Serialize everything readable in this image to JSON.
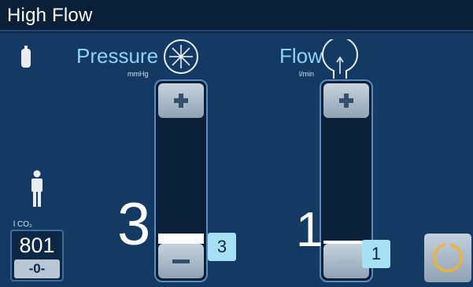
{
  "title": "High Flow",
  "icons": {
    "oxygen_cylinder": "oxygen-cylinder-icon",
    "patient": "adult-patient-icon",
    "pressure_dial": "pressure-dial-icon",
    "flow_loop": "flow-loop-icon",
    "power": "power-icon"
  },
  "co2": {
    "label": "l CO₂",
    "value": "801",
    "sub_value": "-0-"
  },
  "pressure": {
    "label": "Pressure",
    "unit": "mmHg",
    "value": "3",
    "setpoint": "3",
    "level_fraction": 0.08
  },
  "flow": {
    "label": "Flow",
    "unit": "l/min",
    "value": "1",
    "setpoint": "1",
    "level_fraction": 0.02
  },
  "colors": {
    "background": "#143a63",
    "title_bar": "#0a2038",
    "accent_label": "#8ed3f5",
    "value_box": "#a5e0f5",
    "power_ring": "#f2b230"
  }
}
